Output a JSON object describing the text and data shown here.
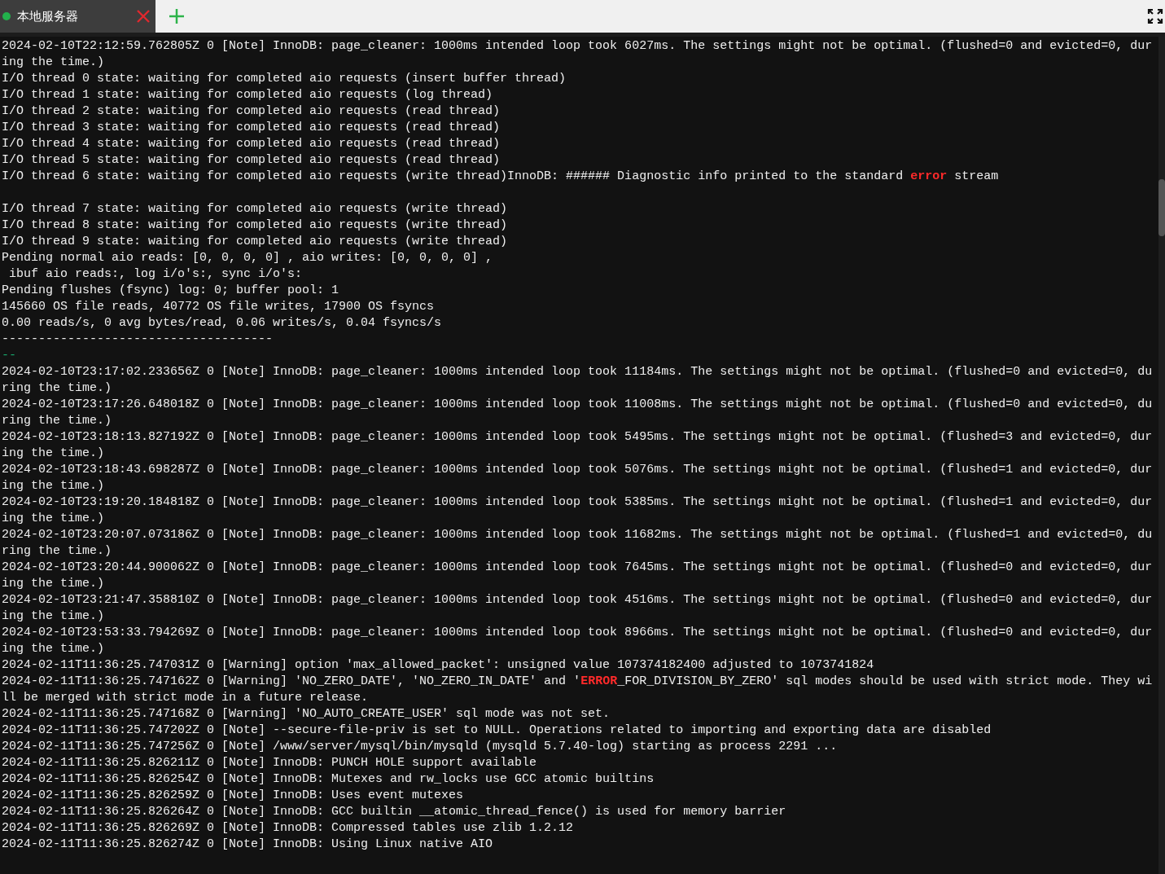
{
  "tabs": [
    {
      "label": "本地服务器"
    }
  ],
  "terminal": {
    "lines": [
      {
        "kind": "plain",
        "text": "2024-02-10T22:12:59.762805Z 0 [Note] InnoDB: page_cleaner: 1000ms intended loop took 6027ms. The settings might not be optimal. (flushed=0 and evicted=0, dur"
      },
      {
        "kind": "plain",
        "text": "ing the time.)"
      },
      {
        "kind": "plain",
        "text": "I/O thread 0 state: waiting for completed aio requests (insert buffer thread)"
      },
      {
        "kind": "plain",
        "text": "I/O thread 1 state: waiting for completed aio requests (log thread)"
      },
      {
        "kind": "plain",
        "text": "I/O thread 2 state: waiting for completed aio requests (read thread)"
      },
      {
        "kind": "plain",
        "text": "I/O thread 3 state: waiting for completed aio requests (read thread)"
      },
      {
        "kind": "plain",
        "text": "I/O thread 4 state: waiting for completed aio requests (read thread)"
      },
      {
        "kind": "plain",
        "text": "I/O thread 5 state: waiting for completed aio requests (read thread)"
      },
      {
        "kind": "segments",
        "segments": [
          {
            "kind": "plain",
            "text": "I/O thread 6 state: waiting for completed aio requests (write thread)InnoDB: ###### Diagnostic info printed to the standard "
          },
          {
            "kind": "error",
            "text": "error"
          },
          {
            "kind": "plain",
            "text": " stream"
          }
        ]
      },
      {
        "kind": "blank"
      },
      {
        "kind": "plain",
        "text": "I/O thread 7 state: waiting for completed aio requests (write thread)"
      },
      {
        "kind": "plain",
        "text": "I/O thread 8 state: waiting for completed aio requests (write thread)"
      },
      {
        "kind": "plain",
        "text": "I/O thread 9 state: waiting for completed aio requests (write thread)"
      },
      {
        "kind": "plain",
        "text": "Pending normal aio reads: [0, 0, 0, 0] , aio writes: [0, 0, 0, 0] ,"
      },
      {
        "kind": "plain",
        "text": " ibuf aio reads:, log i/o's:, sync i/o's:"
      },
      {
        "kind": "plain",
        "text": "Pending flushes (fsync) log: 0; buffer pool: 1"
      },
      {
        "kind": "plain",
        "text": "145660 OS file reads, 40772 OS file writes, 17900 OS fsyncs"
      },
      {
        "kind": "plain",
        "text": "0.00 reads/s, 0 avg bytes/read, 0.06 writes/s, 0.04 fsyncs/s"
      },
      {
        "kind": "plain",
        "text": "-------------------------------------"
      },
      {
        "kind": "green",
        "text": "--"
      },
      {
        "kind": "plain",
        "text": "2024-02-10T23:17:02.233656Z 0 [Note] InnoDB: page_cleaner: 1000ms intended loop took 11184ms. The settings might not be optimal. (flushed=0 and evicted=0, du"
      },
      {
        "kind": "plain",
        "text": "ring the time.)"
      },
      {
        "kind": "plain",
        "text": "2024-02-10T23:17:26.648018Z 0 [Note] InnoDB: page_cleaner: 1000ms intended loop took 11008ms. The settings might not be optimal. (flushed=0 and evicted=0, du"
      },
      {
        "kind": "plain",
        "text": "ring the time.)"
      },
      {
        "kind": "plain",
        "text": "2024-02-10T23:18:13.827192Z 0 [Note] InnoDB: page_cleaner: 1000ms intended loop took 5495ms. The settings might not be optimal. (flushed=3 and evicted=0, dur"
      },
      {
        "kind": "plain",
        "text": "ing the time.)"
      },
      {
        "kind": "plain",
        "text": "2024-02-10T23:18:43.698287Z 0 [Note] InnoDB: page_cleaner: 1000ms intended loop took 5076ms. The settings might not be optimal. (flushed=1 and evicted=0, dur"
      },
      {
        "kind": "plain",
        "text": "ing the time.)"
      },
      {
        "kind": "plain",
        "text": "2024-02-10T23:19:20.184818Z 0 [Note] InnoDB: page_cleaner: 1000ms intended loop took 5385ms. The settings might not be optimal. (flushed=1 and evicted=0, dur"
      },
      {
        "kind": "plain",
        "text": "ing the time.)"
      },
      {
        "kind": "plain",
        "text": "2024-02-10T23:20:07.073186Z 0 [Note] InnoDB: page_cleaner: 1000ms intended loop took 11682ms. The settings might not be optimal. (flushed=1 and evicted=0, du"
      },
      {
        "kind": "plain",
        "text": "ring the time.)"
      },
      {
        "kind": "plain",
        "text": "2024-02-10T23:20:44.900062Z 0 [Note] InnoDB: page_cleaner: 1000ms intended loop took 7645ms. The settings might not be optimal. (flushed=0 and evicted=0, dur"
      },
      {
        "kind": "plain",
        "text": "ing the time.)"
      },
      {
        "kind": "plain",
        "text": "2024-02-10T23:21:47.358810Z 0 [Note] InnoDB: page_cleaner: 1000ms intended loop took 4516ms. The settings might not be optimal. (flushed=0 and evicted=0, dur"
      },
      {
        "kind": "plain",
        "text": "ing the time.)"
      },
      {
        "kind": "plain",
        "text": "2024-02-10T23:53:33.794269Z 0 [Note] InnoDB: page_cleaner: 1000ms intended loop took 8966ms. The settings might not be optimal. (flushed=0 and evicted=0, dur"
      },
      {
        "kind": "plain",
        "text": "ing the time.)"
      },
      {
        "kind": "plain",
        "text": "2024-02-11T11:36:25.747031Z 0 [Warning] option 'max_allowed_packet': unsigned value 107374182400 adjusted to 1073741824"
      },
      {
        "kind": "segments",
        "segments": [
          {
            "kind": "plain",
            "text": "2024-02-11T11:36:25.747162Z 0 [Warning] 'NO_ZERO_DATE', 'NO_ZERO_IN_DATE' and '"
          },
          {
            "kind": "error",
            "text": "ERROR"
          },
          {
            "kind": "plain",
            "text": "_FOR_DIVISION_BY_ZERO' sql modes should be used with strict mode. They wi"
          }
        ]
      },
      {
        "kind": "plain",
        "text": "ll be merged with strict mode in a future release."
      },
      {
        "kind": "plain",
        "text": "2024-02-11T11:36:25.747168Z 0 [Warning] 'NO_AUTO_CREATE_USER' sql mode was not set."
      },
      {
        "kind": "plain",
        "text": "2024-02-11T11:36:25.747202Z 0 [Note] --secure-file-priv is set to NULL. Operations related to importing and exporting data are disabled"
      },
      {
        "kind": "plain",
        "text": "2024-02-11T11:36:25.747256Z 0 [Note] /www/server/mysql/bin/mysqld (mysqld 5.7.40-log) starting as process 2291 ..."
      },
      {
        "kind": "plain",
        "text": "2024-02-11T11:36:25.826211Z 0 [Note] InnoDB: PUNCH HOLE support available"
      },
      {
        "kind": "plain",
        "text": "2024-02-11T11:36:25.826254Z 0 [Note] InnoDB: Mutexes and rw_locks use GCC atomic builtins"
      },
      {
        "kind": "plain",
        "text": "2024-02-11T11:36:25.826259Z 0 [Note] InnoDB: Uses event mutexes"
      },
      {
        "kind": "plain",
        "text": "2024-02-11T11:36:25.826264Z 0 [Note] InnoDB: GCC builtin __atomic_thread_fence() is used for memory barrier"
      },
      {
        "kind": "plain",
        "text": "2024-02-11T11:36:25.826269Z 0 [Note] InnoDB: Compressed tables use zlib 1.2.12"
      },
      {
        "kind": "plain",
        "text": "2024-02-11T11:36:25.826274Z 0 [Note] InnoDB: Using Linux native AIO"
      }
    ]
  }
}
